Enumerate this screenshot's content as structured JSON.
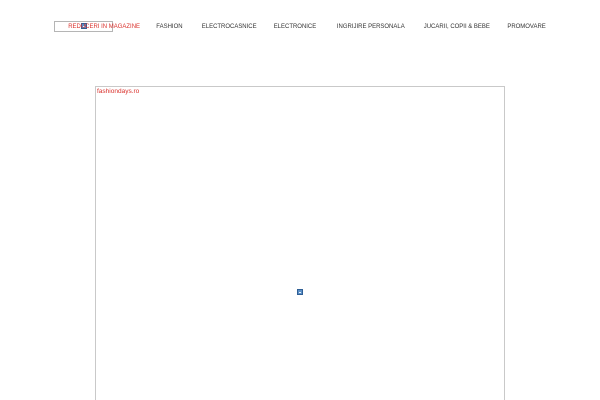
{
  "header": {
    "logo": {
      "icon": "broken-image-icon"
    },
    "nav": [
      {
        "label": "REDUCERI IN MAGAZINE",
        "active": true
      },
      {
        "label": "FASHION",
        "active": false
      },
      {
        "label": "ELECTROCASNICE",
        "active": false
      },
      {
        "label": "ELECTRONICE",
        "active": false
      },
      {
        "label": "INGRIJIRE PERSONALA",
        "active": false
      },
      {
        "label": "JUCARII, COPII & BEBE",
        "active": false
      },
      {
        "label": "PROMOVARE",
        "active": false
      }
    ]
  },
  "main": {
    "ad": {
      "link_text": "fashiondays.ro",
      "icon": "broken-image-icon"
    }
  },
  "colors": {
    "accent": "#d9302b",
    "nav_text": "#333333",
    "border": "#c9c9c9"
  }
}
